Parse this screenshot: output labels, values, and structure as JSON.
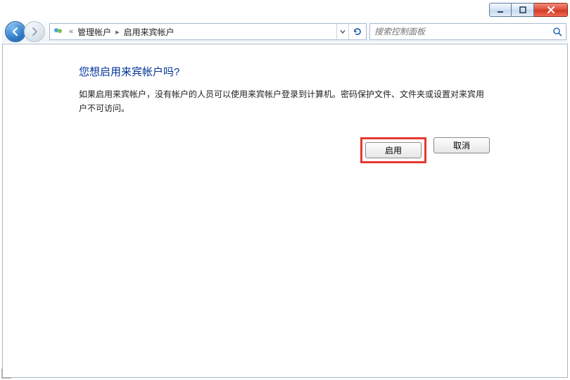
{
  "window": {
    "minimize_label": "minimize",
    "maximize_label": "maximize",
    "close_label": "close"
  },
  "breadcrumb": {
    "segment1": "管理帐户",
    "segment2": "启用来宾帐户"
  },
  "search": {
    "placeholder": "搜索控制面板"
  },
  "page": {
    "heading": "您想启用来宾帐户吗?",
    "body": "如果启用来宾帐户，没有帐户的人员可以使用来宾帐户登录到计算机。密码保护文件、文件夹或设置对来宾用户不可访问。"
  },
  "buttons": {
    "enable": "启用",
    "cancel": "取消"
  }
}
